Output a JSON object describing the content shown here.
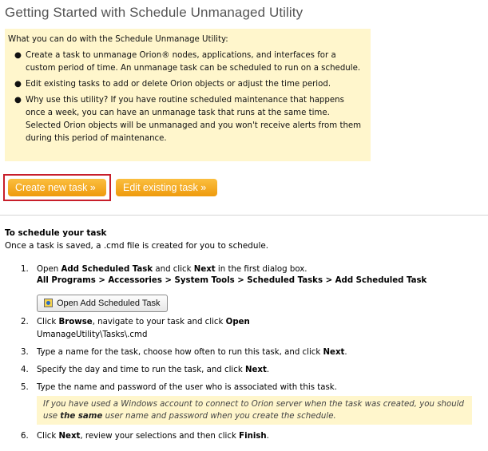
{
  "page": {
    "title": "Getting Started with Schedule Unmanaged Utility"
  },
  "info": {
    "intro": "What you can do with the Schedule Unmanage Utility:",
    "bullets": [
      "Create a task to unmanage Orion® nodes, applications, and interfaces for a custom period of time. An unmanage task can be scheduled to run on a schedule.",
      "Edit existing tasks to add or delete Orion objects or adjust the time period.",
      "Why use this utility? If you have routine scheduled maintenance that happens once a week, you can have an unmanage task that runs at the same time. Selected Orion objects will be unmanaged and you won't receive alerts from them during this period of maintenance."
    ],
    "bullet_char": "●"
  },
  "buttons": {
    "create": "Create new task »",
    "edit": "Edit existing task »"
  },
  "schedule": {
    "heading": "To schedule your task",
    "subtext": "Once a task is saved, a .cmd file is created for you to schedule.",
    "steps": {
      "s1": {
        "num": "1.",
        "pre": "Open ",
        "b1": "Add Scheduled Task",
        "mid": " and click ",
        "b2": "Next",
        "post": " in the first dialog box.",
        "path": "All Programs > Accessories > System Tools > Scheduled Tasks > Add Scheduled Task",
        "button": "Open Add Scheduled Task"
      },
      "s2": {
        "num": "2.",
        "pre": "Click ",
        "b1": "Browse",
        "mid": ", navigate to your task and click ",
        "b2": "Open",
        "line2": "UmanageUtility\\Tasks\\.cmd"
      },
      "s3": {
        "num": "3.",
        "pre": "Type a name for the task, choose how often to run this task, and click ",
        "b1": "Next",
        "post": "."
      },
      "s4": {
        "num": "4.",
        "pre": "Specify the day and time to run the task, and click ",
        "b1": "Next",
        "post": "."
      },
      "s5": {
        "num": "5.",
        "text": "Type the name and password of the user who is associated with this task.",
        "note_pre": "If you have used a Windows account to connect to Orion server when the task was created, you should use ",
        "note_bold": "the same",
        "note_post": " user name and password when you create the schedule."
      },
      "s6": {
        "num": "6.",
        "pre": "Click ",
        "b1": "Next",
        "mid": ", review your selections and then click ",
        "b2": "Finish",
        "post": "."
      }
    }
  },
  "colors": {
    "info_bg": "#fff6cc",
    "button_orange": "#f4a623",
    "highlight_red": "#c81e2a",
    "title_gray": "#555555"
  }
}
